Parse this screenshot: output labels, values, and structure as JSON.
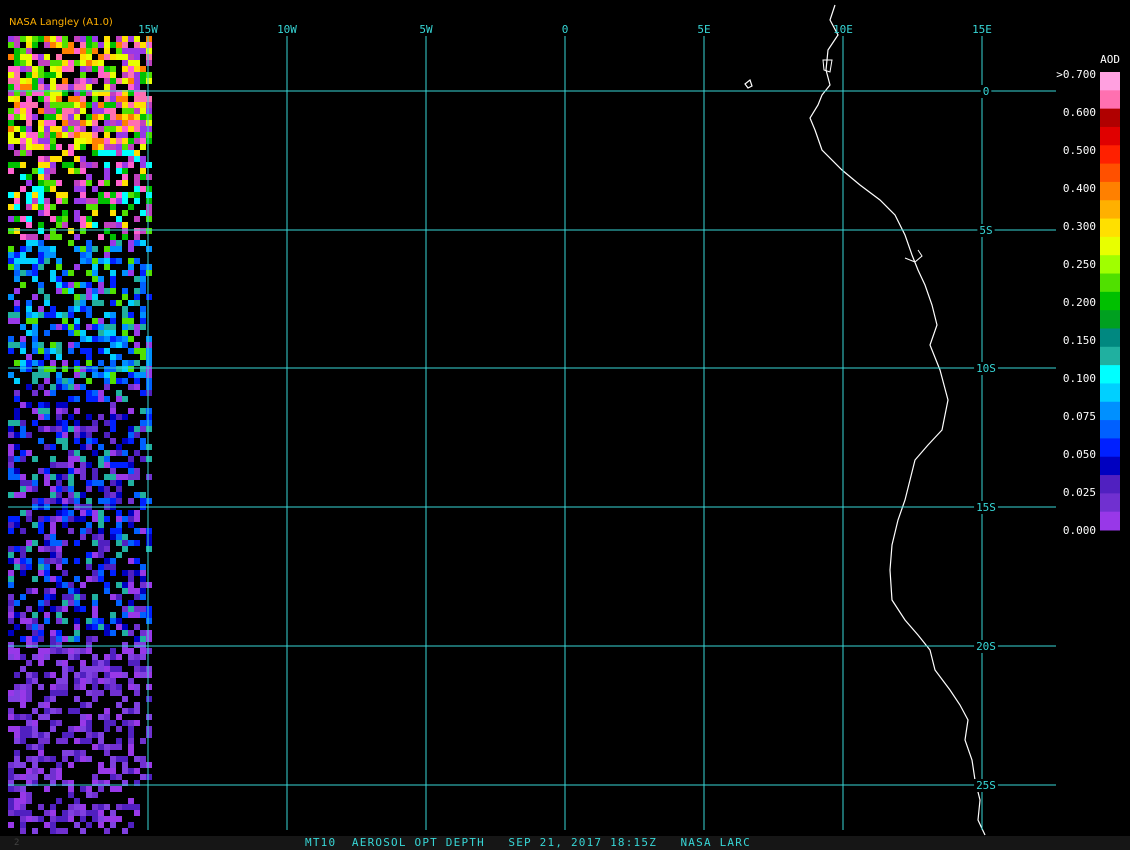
{
  "header": {
    "brand": "NASA Langley (A1.0)"
  },
  "map": {
    "product": "AOD",
    "gridline_color": "#37d6d6",
    "coast_color": "#ffffff",
    "longitude_labels": [
      "15W",
      "10W",
      "5W",
      "0",
      "5E",
      "10E",
      "15E"
    ],
    "latitude_labels": [
      "0",
      "5S",
      "10S",
      "15S",
      "20S",
      "25S"
    ]
  },
  "colorbar": {
    "title": "AOD",
    "tick_labels": [
      ">0.700",
      "0.600",
      "0.500",
      "0.400",
      "0.300",
      "0.250",
      "0.200",
      "0.150",
      "0.100",
      "0.075",
      "0.050",
      "0.025",
      "0.000"
    ],
    "colors": [
      "#ffa0e0",
      "#ff70b0",
      "#b00000",
      "#e00000",
      "#ff2000",
      "#ff5000",
      "#ff8000",
      "#ffb000",
      "#ffe000",
      "#e8ff00",
      "#a0ff00",
      "#50e000",
      "#00c000",
      "#00a020",
      "#008880",
      "#20b0a0",
      "#00ffff",
      "#00d0ff",
      "#0090ff",
      "#0060ff",
      "#0020ff",
      "#0000c0",
      "#5020c0",
      "#7030d0",
      "#9838e8"
    ]
  },
  "footer": {
    "caption": "MT10  AEROSOL OPT DEPTH   SEP 21, 2017 18:15Z   NASA LARC",
    "corner": "2"
  }
}
